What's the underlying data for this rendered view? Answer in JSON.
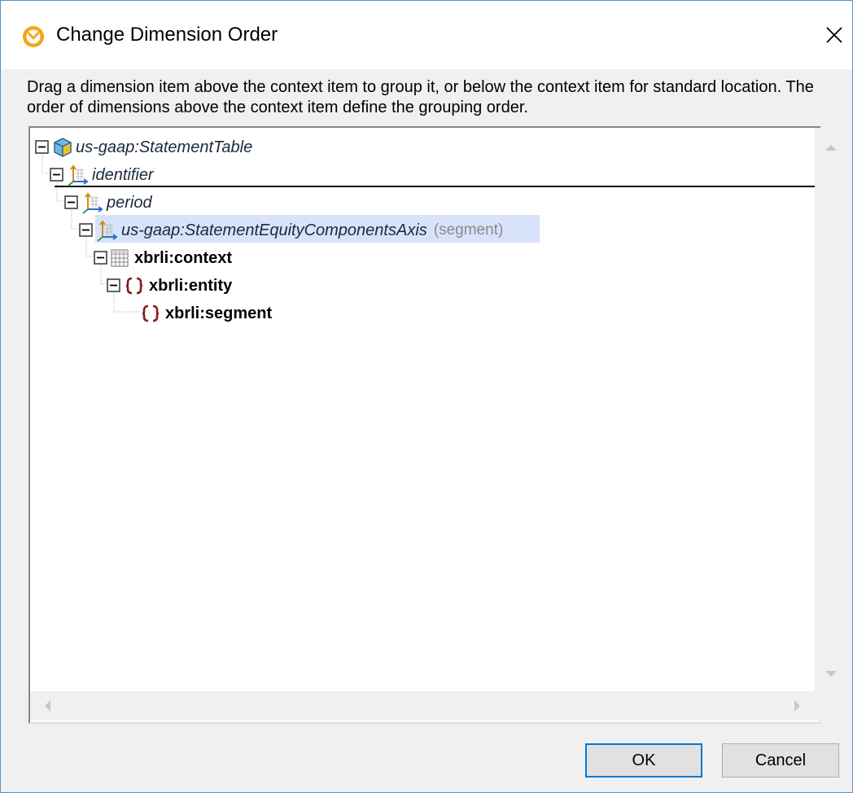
{
  "dialog": {
    "title": "Change Dimension Order",
    "instructions": "Drag a dimension item above the context item to group it, or below the context item for standard location. The order of dimensions above the context item define the grouping order."
  },
  "tree": {
    "items": [
      {
        "label": "us-gaap:StatementTable",
        "icon": "hypercube-icon"
      },
      {
        "label": "identifier",
        "icon": "dimension-icon"
      },
      {
        "label": "period",
        "icon": "dimension-icon"
      },
      {
        "label": "us-gaap:StatementEquityComponentsAxis",
        "suffix": "(segment)",
        "icon": "dimension-icon",
        "selected": true
      },
      {
        "label": "xbrli:context",
        "icon": "table-grid-icon"
      },
      {
        "label": "xbrli:entity",
        "icon": "element-braces-icon"
      },
      {
        "label": "xbrli:segment",
        "icon": "element-braces-icon"
      }
    ]
  },
  "buttons": {
    "ok": "OK",
    "cancel": "Cancel"
  },
  "colors": {
    "accent": "#0078d7",
    "selection": "#d9e2fb",
    "braces": "#8b1a1a"
  }
}
